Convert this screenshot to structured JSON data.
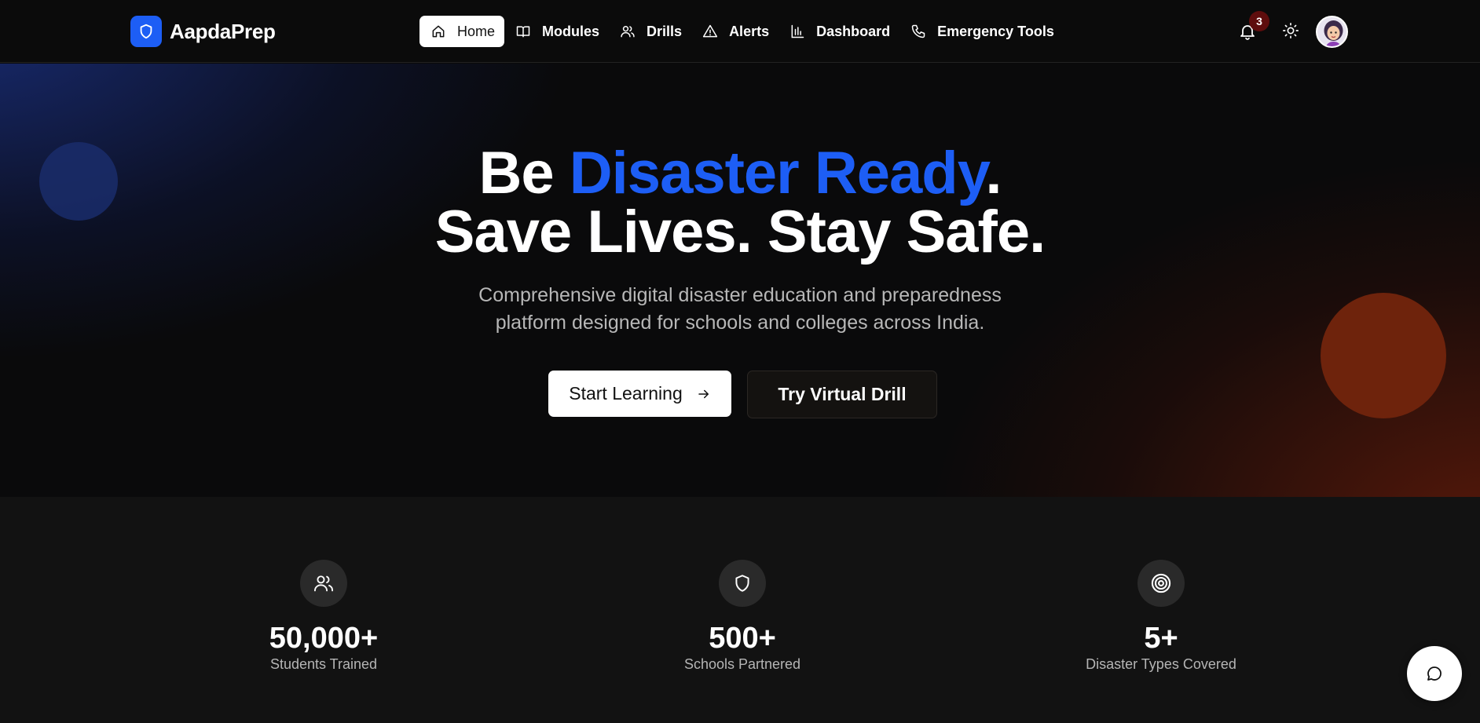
{
  "brand": {
    "name": "AapdaPrep",
    "logo_icon": "shield-icon",
    "accent_color": "#1d5ef5"
  },
  "nav": {
    "items": [
      {
        "label": "Home",
        "icon": "home-icon",
        "active": true
      },
      {
        "label": "Modules",
        "icon": "book-icon"
      },
      {
        "label": "Drills",
        "icon": "users-icon"
      },
      {
        "label": "Alerts",
        "icon": "alert-triangle-icon"
      },
      {
        "label": "Dashboard",
        "icon": "bar-chart-icon"
      },
      {
        "label": "Emergency Tools",
        "icon": "phone-icon"
      }
    ],
    "notification_count": "3"
  },
  "hero": {
    "title_part1": "Be ",
    "title_accent": "Disaster Ready",
    "title_part2": ".",
    "title_line2": "Save Lives. Stay Safe.",
    "subtitle": "Comprehensive digital disaster education and preparedness platform designed for schools and colleges across India.",
    "primary_button": "Start Learning",
    "secondary_button": "Try Virtual Drill"
  },
  "stats": [
    {
      "value": "50,000+",
      "label": "Students Trained",
      "icon": "users-icon"
    },
    {
      "value": "500+",
      "label": "Schools Partnered",
      "icon": "shield-icon"
    },
    {
      "value": "5+",
      "label": "Disaster Types Covered",
      "icon": "target-icon"
    }
  ],
  "colors": {
    "hero_blue": "#1a2d6b",
    "hero_orange": "#6e230c",
    "badge": "#5e0d0d"
  }
}
